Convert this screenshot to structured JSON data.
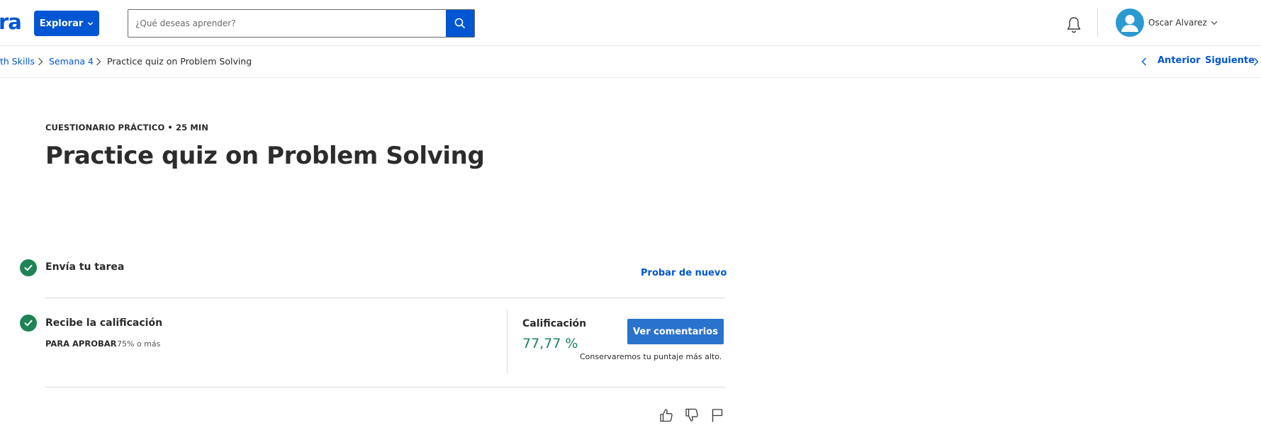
{
  "header": {
    "logo_fragment": "ra",
    "explore_label": "Explorar",
    "search_placeholder": "¿Qué deseas aprender?",
    "user_name": "Oscar Alvarez"
  },
  "breadcrumb": {
    "items": [
      "th Skills",
      "Semana 4",
      "Practice quiz on Problem Solving"
    ],
    "prev_label": "Anterior",
    "next_label": "Siguiente"
  },
  "main": {
    "eyebrow": "CUESTIONARIO PRÁCTICO • 25 MIN",
    "title": "Practice quiz on Problem Solving",
    "steps": {
      "submit_title": "Envía tu tarea",
      "retry_label": "Probar de nuevo",
      "grade_title": "Recibe la calificación",
      "pass_label": "PARA APROBAR",
      "pass_value": "75% o más"
    },
    "grade": {
      "label": "Calificación",
      "value": "77,77 %",
      "feedback_button": "Ver comentarios",
      "note": "Conservaremos tu puntaje más alto."
    }
  },
  "colors": {
    "brand_blue": "#0056d2",
    "button_blue": "#2a73cc",
    "success_green": "#1f8354",
    "avatar_blue": "#2a9ad1"
  },
  "icons": [
    "chevron-down-icon",
    "search-icon",
    "bell-icon",
    "user-avatar-icon",
    "chevron-right-icon",
    "chevron-left-icon",
    "check-icon",
    "thumbs-up-icon",
    "thumbs-down-icon",
    "flag-icon"
  ]
}
